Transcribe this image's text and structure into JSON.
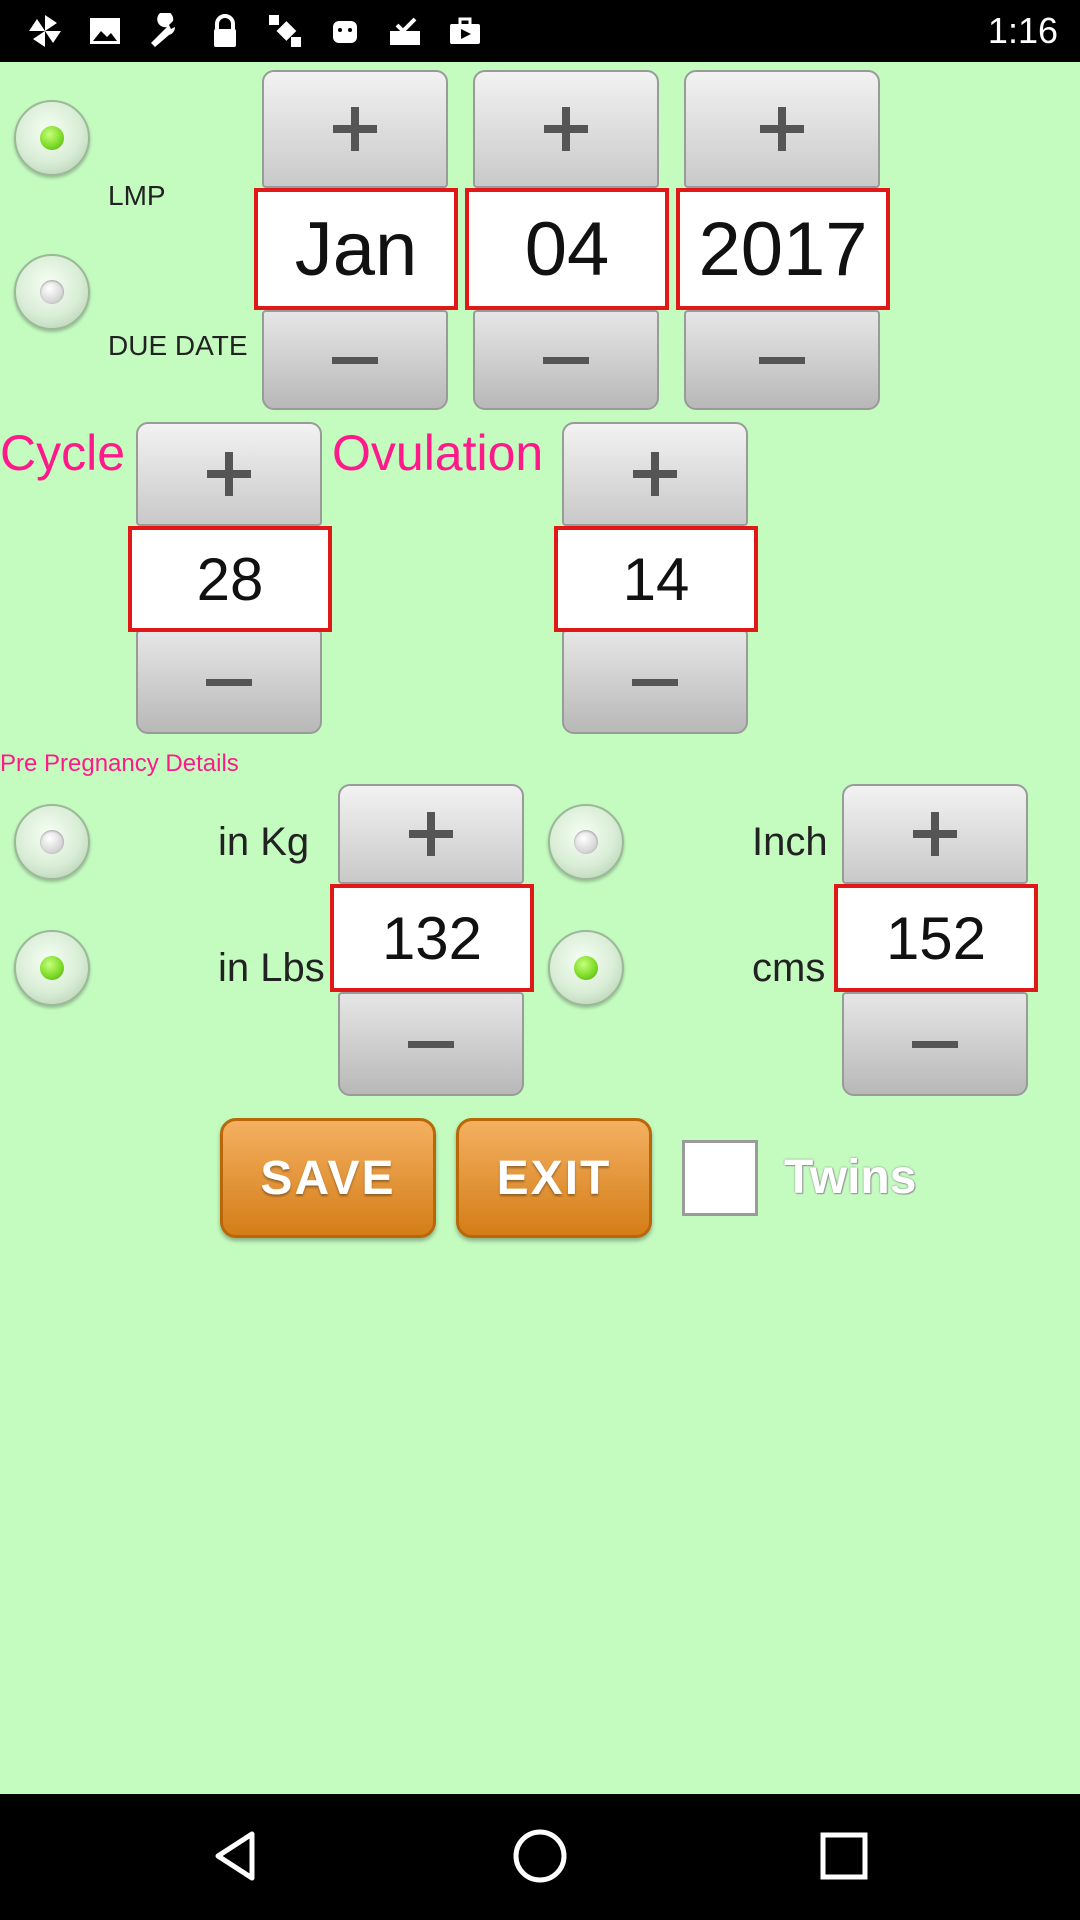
{
  "status_bar": {
    "time": "1:16",
    "icons": [
      "pinwheel-icon",
      "image-icon",
      "wrench-icon",
      "lock-icon",
      "fake-gps-icon",
      "android-icon",
      "inbox-check-icon",
      "briefcase-icon"
    ]
  },
  "date_picker": {
    "lmp_label": "LMP",
    "due_date_label": "DUE DATE",
    "lmp_selected": true,
    "month": "Jan",
    "day": "04",
    "year": "2017"
  },
  "cycle": {
    "label": "Cycle",
    "value": "28"
  },
  "ovulation": {
    "label": "Ovulation",
    "value": "14"
  },
  "pre_pregnancy": {
    "title": "Pre Pregnancy Details",
    "kg_label": "in Kg",
    "lbs_label": "in Lbs",
    "weight_unit_selected": "lbs",
    "weight": "132",
    "inch_label": "Inch",
    "cms_label": "cms",
    "height_unit_selected": "cms",
    "height": "152"
  },
  "actions": {
    "save_label": "SAVE",
    "exit_label": "EXIT",
    "twins_label": "Twins",
    "twins_checked": false
  },
  "colors": {
    "background": "#c4fcc0",
    "accent_pink": "#ff1a8c",
    "value_border": "#e01818",
    "button_orange": "#e0902c"
  },
  "nav": {
    "icons": [
      "back-icon",
      "home-icon",
      "recents-icon"
    ]
  }
}
